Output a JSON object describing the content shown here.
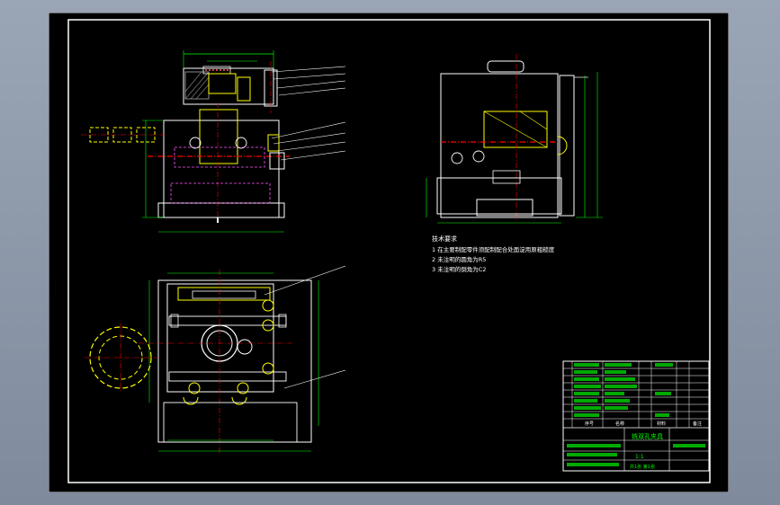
{
  "colors": {
    "background": "#000000",
    "frame": "#ffffff",
    "part_outline": "#ffffff",
    "dimension": "#00ff00",
    "centerline": "#ff0000",
    "hidden_detail": "#ffff00",
    "annotation_green": "#00ff00",
    "cyan_detail": "#00c8c8",
    "magenta_detail": "#ff55ff"
  },
  "technical_requirements": {
    "title": "技术要求",
    "items": [
      "1 在主要制配零件须配制配合处面淀用原粗糙度",
      "2 未注明的圆角为R5",
      "3 未注明的倒角为C2"
    ]
  },
  "title_block": {
    "drawing_title": "铣双孔夹具",
    "header_labels": [
      "序号",
      "名称",
      "材料",
      "备注"
    ],
    "scale": "1:1",
    "sheet_info": "共1张 第1张"
  },
  "icons": {
    "frame": "drawing-frame-icon",
    "section_circle": "section-circle-icon",
    "leader": "leader-arrow-icon"
  }
}
